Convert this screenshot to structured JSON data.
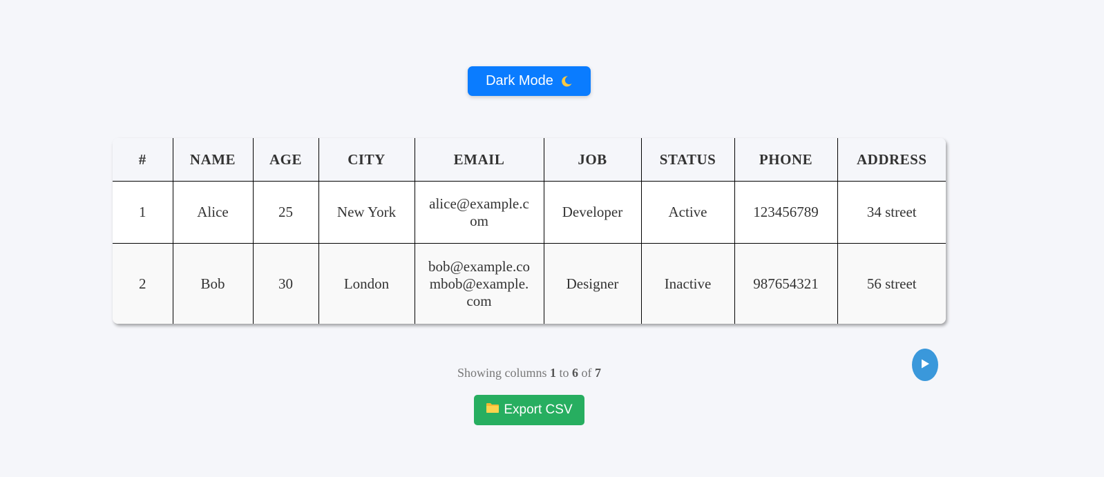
{
  "theme_toggle": {
    "label": "Dark Mode",
    "icon": "moon-icon"
  },
  "table": {
    "columns": [
      "#",
      "NAME",
      "AGE",
      "CITY",
      "EMAIL",
      "JOB",
      "STATUS",
      "PHONE",
      "ADDRESS"
    ],
    "rows": [
      [
        "1",
        "Alice",
        "25",
        "New York",
        "alice@example.com",
        "Developer",
        "Active",
        "123456789",
        "34 street"
      ],
      [
        "2",
        "Bob",
        "30",
        "London",
        "bob@example.combob@example.com",
        "Designer",
        "Inactive",
        "987654321",
        "56 street"
      ]
    ]
  },
  "pagination": {
    "prefix": "Showing columns",
    "start": "1",
    "to_word": "to",
    "end": "6",
    "of_word": "of",
    "total": "7",
    "next_icon": "play-icon"
  },
  "export": {
    "label": "Export CSV",
    "icon": "folder-icon"
  },
  "colors": {
    "background": "#f5f6fa",
    "primary_button": "#0a7cff",
    "export_button": "#27ae60",
    "next_button": "#3a98db"
  }
}
